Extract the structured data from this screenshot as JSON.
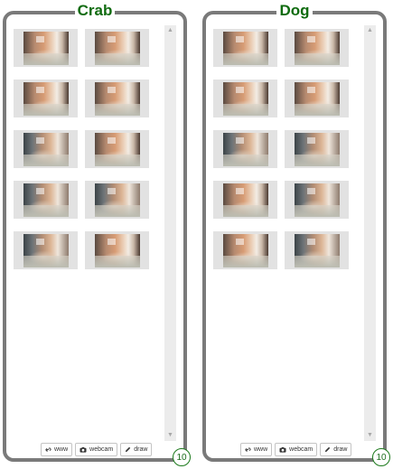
{
  "classes": [
    {
      "name": "Crab",
      "sample_count": "10",
      "samples": 10,
      "buttons": {
        "www": "www",
        "webcam": "webcam",
        "draw": "draw"
      }
    },
    {
      "name": "Dog",
      "sample_count": "10",
      "samples": 10,
      "buttons": {
        "www": "www",
        "webcam": "webcam",
        "draw": "draw"
      }
    }
  ],
  "icons": {
    "www": "link-icon",
    "webcam": "camera-icon",
    "draw": "pencil-icon",
    "scroll_up": "scroll-up-arrow-icon",
    "scroll_down": "scroll-down-arrow-icon"
  },
  "colors": {
    "title": "#0f6b0f",
    "panel_border": "#7a7a7a",
    "thumbnail_background": "#e2e2e2",
    "count_badge": "#1c7a1c"
  }
}
